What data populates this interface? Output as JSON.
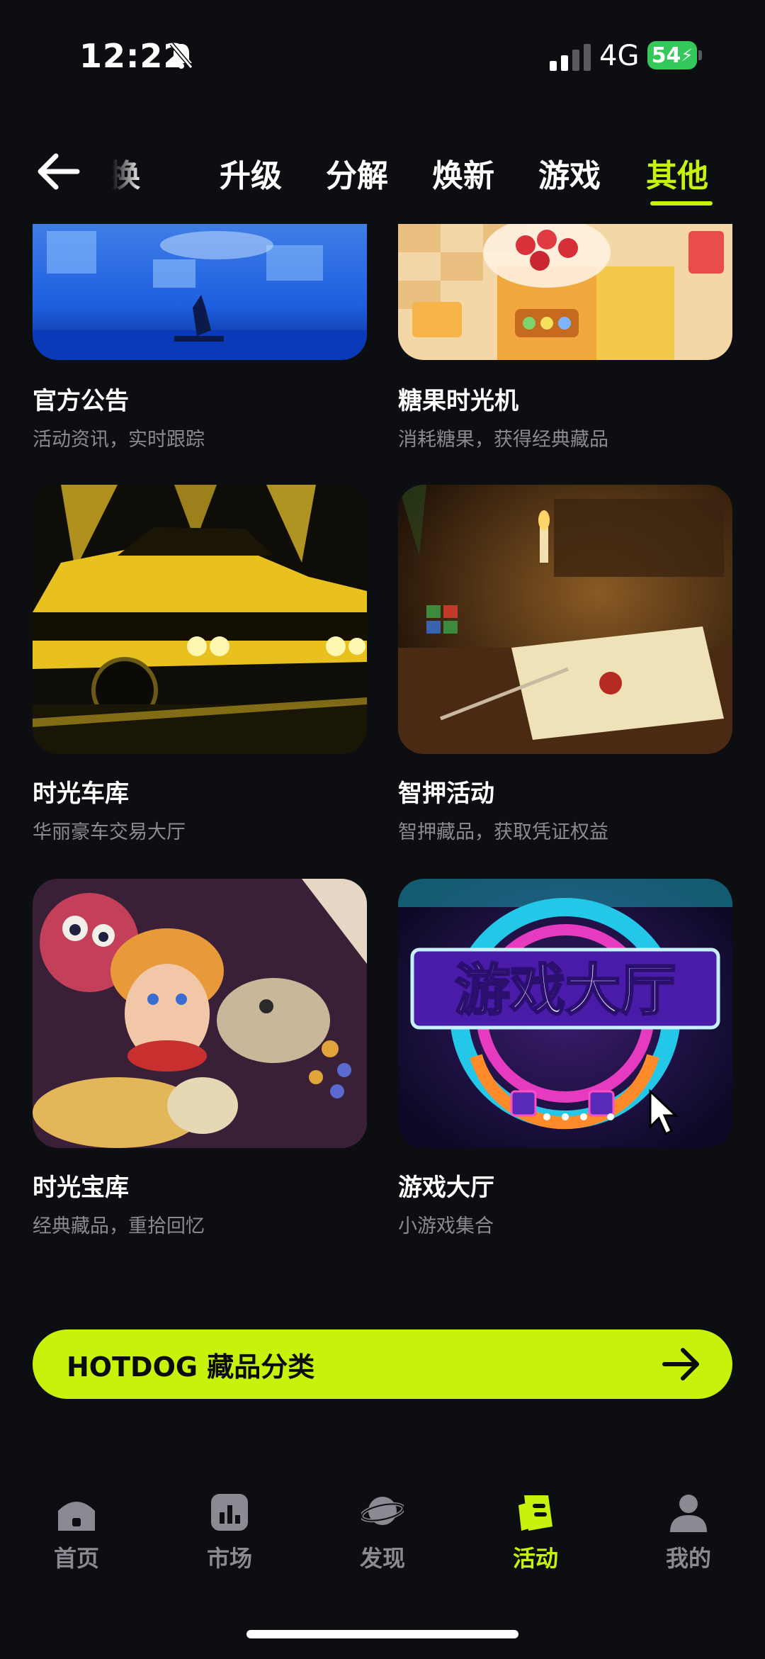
{
  "status": {
    "time": "12:22",
    "network": "4G",
    "battery": "54"
  },
  "tabs": [
    {
      "label": "转换"
    },
    {
      "label": "升级"
    },
    {
      "label": "分解"
    },
    {
      "label": "焕新"
    },
    {
      "label": "游戏"
    },
    {
      "label": "其他"
    }
  ],
  "cards": [
    {
      "title": "官方公告",
      "subtitle": "活动资讯，实时跟踪"
    },
    {
      "title": "糖果时光机",
      "subtitle": "消耗糖果，获得经典藏品"
    },
    {
      "title": "时光车库",
      "subtitle": "华丽豪车交易大厅"
    },
    {
      "title": "智押活动",
      "subtitle": "智押藏品，获取凭证权益"
    },
    {
      "title": "时光宝库",
      "subtitle": "经典藏品，重拾回忆"
    },
    {
      "title": "游戏大厅",
      "subtitle": "小游戏集合",
      "image_text": "游戏大厅"
    }
  ],
  "cta": {
    "label": "HOTDOG 藏品分类"
  },
  "nav": [
    {
      "label": "首页",
      "icon": "home-icon"
    },
    {
      "label": "市场",
      "icon": "market-icon"
    },
    {
      "label": "发现",
      "icon": "planet-icon"
    },
    {
      "label": "活动",
      "icon": "activity-icon"
    },
    {
      "label": "我的",
      "icon": "profile-icon"
    }
  ],
  "colors": {
    "accent": "#c6f20c",
    "background": "#0d0e12",
    "muted": "#8a8b92"
  }
}
